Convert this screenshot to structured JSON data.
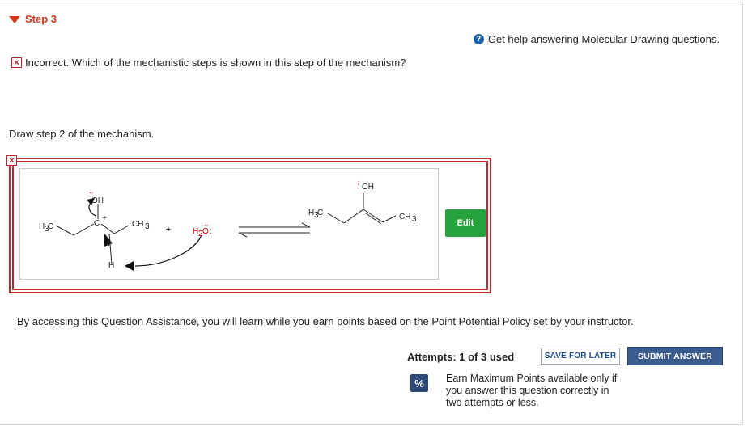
{
  "step": {
    "title": "Step 3"
  },
  "help": {
    "icon": "?",
    "label": "Get help answering Molecular Drawing questions."
  },
  "feedback": {
    "icon": "×",
    "text": "Incorrect. Which of the mechanistic steps is shown in this step of the mechanism?"
  },
  "instruction": "Draw step 2 of the mechanism.",
  "answer": {
    "status_icon": "×",
    "edit_label": "Edit",
    "structure": {
      "reactant_oh": "OH",
      "reactant_c": "C",
      "reactant_h": "H",
      "reactant_ch3": "CH",
      "reactant_ch3_sub": "3",
      "reactant_h3c": "H",
      "reactant_h3c_sub": "3",
      "reactant_h3c_c": "C",
      "plus": "+",
      "water_h": "H",
      "water_sub": "2",
      "water_o": "O",
      "product_oh": "OH",
      "product_h3c": "H",
      "product_h3c_sub": "3",
      "product_h3c_c": "C",
      "product_ch3": "CH",
      "product_ch3_sub": "3"
    }
  },
  "assistance_text": "By accessing this Question Assistance, you will learn while you earn points based on the Point Potential Policy set by your instructor.",
  "attempts": "Attempts: 1 of 3 used",
  "buttons": {
    "save": "SAVE FOR LATER",
    "submit": "SUBMIT ANSWER"
  },
  "policy": {
    "icon": "%",
    "text": "Earn Maximum Points available only if you answer this question correctly in two attempts or less."
  },
  "colors": {
    "error": "#c0262d",
    "accent": "#d4341c",
    "edit": "#27a33d",
    "submit": "#3a5b8e"
  }
}
